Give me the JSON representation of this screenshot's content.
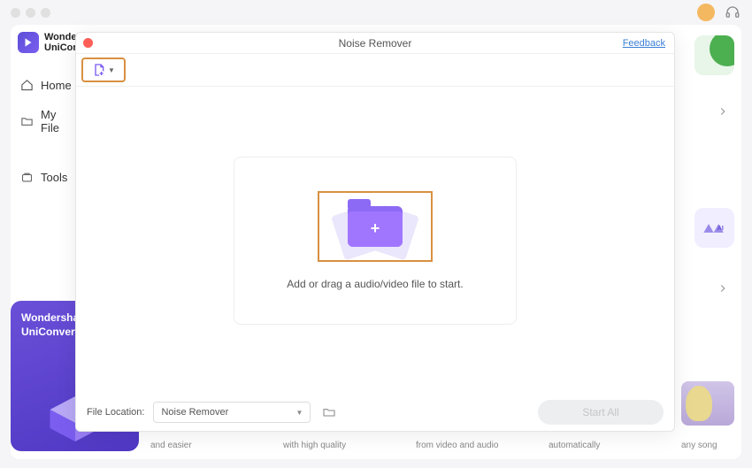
{
  "app": {
    "name_line1": "Wonders",
    "name_line2": "UniConve"
  },
  "sidebar": {
    "items": [
      {
        "label": "Home"
      },
      {
        "label": "My File"
      },
      {
        "label": "Tools"
      }
    ]
  },
  "promo": {
    "title_line1": "Wondershare",
    "title_line2": "UniConvert"
  },
  "captions": {
    "c1": "and easier",
    "c2": "with high quality",
    "c3": "from video and audio",
    "c4": "automatically",
    "c5": "any song"
  },
  "modal": {
    "title": "Noise Remover",
    "feedback": "Feedback",
    "drop_text": "Add or drag a audio/video file to start.",
    "footer_label": "File Location:",
    "location_value": "Noise Remover",
    "start_label": "Start All"
  }
}
